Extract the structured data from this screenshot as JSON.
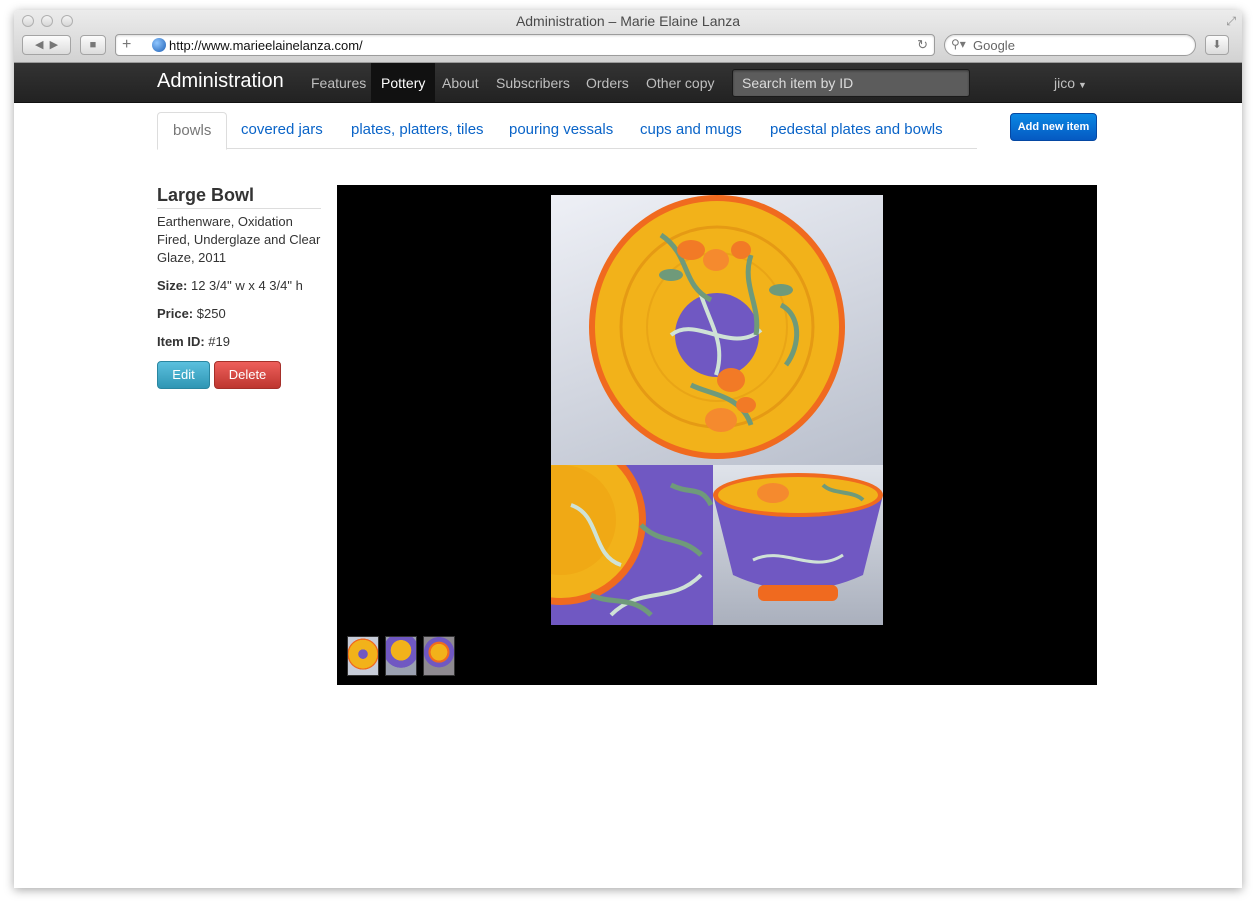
{
  "browser": {
    "window_title": "Administration – Marie Elaine Lanza",
    "url": "http://www.marieelainelanza.com/",
    "search_placeholder": "Google"
  },
  "navbar": {
    "brand": "Administration",
    "items": [
      {
        "label": "Features",
        "active": false
      },
      {
        "label": "Pottery",
        "active": true
      },
      {
        "label": "About",
        "active": false
      },
      {
        "label": "Subscribers",
        "active": false
      },
      {
        "label": "Orders",
        "active": false
      },
      {
        "label": "Other copy",
        "active": false
      }
    ],
    "search_placeholder": "Search item by ID",
    "user": "jico"
  },
  "tabs": [
    {
      "label": "bowls",
      "active": true
    },
    {
      "label": "covered jars",
      "active": false
    },
    {
      "label": "plates, platters, tiles",
      "active": false
    },
    {
      "label": "pouring vessals",
      "active": false
    },
    {
      "label": "cups and mugs",
      "active": false
    },
    {
      "label": "pedestal plates and bowls",
      "active": false
    }
  ],
  "add_button": "Add new item",
  "item": {
    "title": "Large Bowl",
    "description": "Earthenware, Oxidation Fired, Underglaze and Clear Glaze, 2011",
    "size_label": "Size:",
    "size_value": "12 3/4\" w x 4 3/4\" h",
    "price_label": "Price:",
    "price_value": "$250",
    "id_label": "Item ID:",
    "id_value": "#19",
    "edit_label": "Edit",
    "delete_label": "Delete"
  },
  "colors": {
    "navbar_bg": "#222222",
    "link": "#0a64c8",
    "primary": "#0a6fd8",
    "info": "#49afcd",
    "danger": "#da4f49",
    "glaze_yellow": "#f2b21a",
    "glaze_orange": "#f06a1f",
    "glaze_purple": "#6f55c0",
    "leaf_green": "#6f9a7a"
  }
}
